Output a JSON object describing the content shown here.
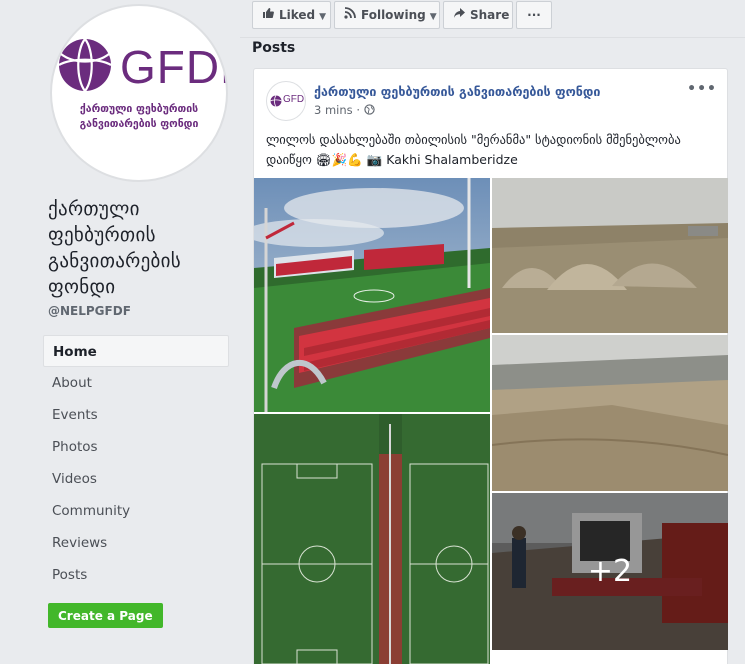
{
  "sidebar": {
    "logo_text": "GFDF",
    "logo_sub": "ქართული ფეხბურთის განვითარების ფონდი",
    "page_name": "ქართული ფეხბურთის განვითარების ფონდი",
    "handle": "@NELPGFDF",
    "nav": [
      "Home",
      "About",
      "Events",
      "Photos",
      "Videos",
      "Community",
      "Reviews",
      "Posts"
    ],
    "active": "Home",
    "create_page": "Create a Page"
  },
  "actions": {
    "liked": "Liked",
    "following": "Following",
    "share": "Share",
    "more": "···"
  },
  "posts_heading": "Posts",
  "post": {
    "avatar_text": "GFDF",
    "author": "ქართული ფეხბურთის განვითარების ფონდი",
    "time": "3 mins",
    "text_line1": "ლილოს დასახლებაში თბილისის \"მერანმა\" სტადიონის მშენებლობა",
    "text_line2": "დაიწყო 🏟🎉💪 📷 Kakhi Shalamberidze",
    "more_photos": "+2"
  },
  "colors": {
    "brand_purple": "#6b2c7e",
    "link_blue": "#365899",
    "green_button": "#42b72a"
  }
}
